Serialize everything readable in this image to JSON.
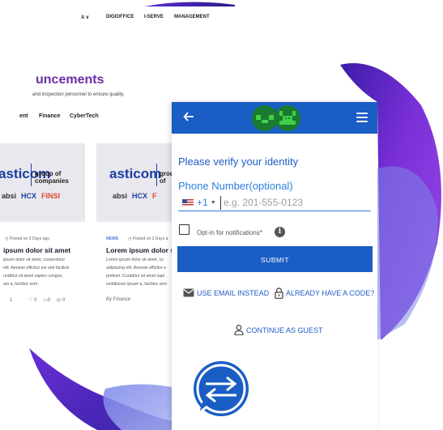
{
  "site": {
    "nav": {
      "item1_suffix": "A ∨",
      "item2": "DIGIOFFICE",
      "item3": "I-SERVE",
      "item4": "MANAGEMENT"
    },
    "heading": "uncements",
    "subheading": "and inspection personnel to ensure quality.",
    "tabs": {
      "tab1": "ent",
      "tab2": "Finance",
      "tab3": "CyberTech"
    },
    "cards": [
      {
        "logo": "asticom",
        "group": "group of companies",
        "brands": [
          "absi",
          "HCX",
          "FINSI"
        ],
        "tag": "",
        "meta": "Posted on 3 Days ago",
        "title": "ipsum dolor sit amet",
        "text": "ipsum dolor sit amet, consectetur elit. Aenean efficitur est sed facilisis urabitur sit amet sapien congue, am a, facilisis sem.",
        "stats": {
          "count1": "1",
          "likes": "0",
          "comments": "0",
          "views": "0"
        }
      },
      {
        "logo": "asticom",
        "group": "group of",
        "brands": [
          "absi",
          "HCX",
          "F"
        ],
        "tag": "NEWS",
        "meta": "Posted on 3 Days a",
        "title": "Lorem ipsum dolor sit",
        "text": "Lorem ipsum dolor sit amet, co adipiscing elit. Aenean efficitur e pretium. Curabitur sit amet sapi vestibulum ipsum a, facilisis sem",
        "stats": {
          "by": "By Finance"
        }
      }
    ]
  },
  "widget": {
    "verify_title": "Please verify your identity",
    "phone_label": "Phone Number(optional)",
    "country_code": "+1",
    "phone_placeholder": "e.g. 201-555-0123",
    "optin_label": "Opt-in for notifications*",
    "info_icon": "i",
    "submit_label": "SUBMIT",
    "use_email_label": "USE EMAIL INSTEAD",
    "have_code_label": "ALREADY HAVE A CODE?",
    "guest_label": "CONTINUE AS GUEST"
  },
  "colors": {
    "header_blue": "#1a5dc4",
    "link_blue": "#2d7fe0",
    "accent_purple": "#6b2fa3",
    "logo_green": "#3fd14a"
  },
  "icons": {
    "back": "arrow-left-icon",
    "menu": "hamburger-menu-icon",
    "info": "info-icon",
    "email": "envelope-icon",
    "code": "padlock-icon",
    "guest": "person-icon",
    "flag": "us-flag-icon"
  }
}
